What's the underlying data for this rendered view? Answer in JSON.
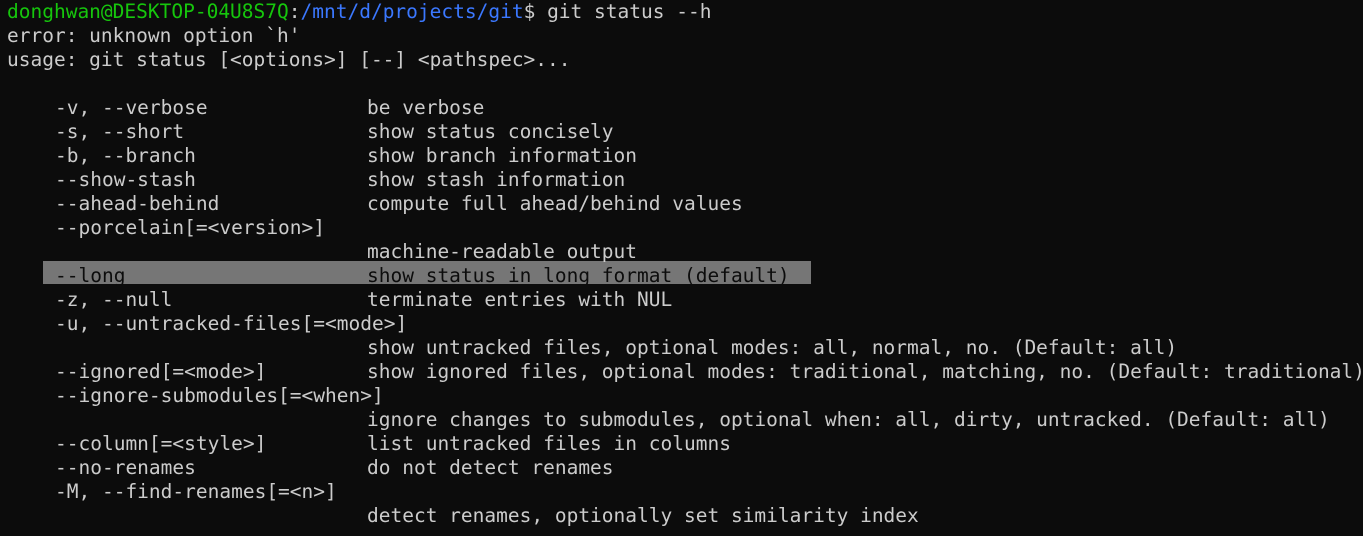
{
  "prompt": {
    "user_host": "donghwan@DESKTOP-04U8S7Q",
    "separator": ":",
    "cwd": "/mnt/d/projects/git",
    "symbol": "$",
    "command": " git status --h"
  },
  "error_line": "error: unknown option `h'",
  "usage_line": "usage: git status [<options>] [--] <pathspec>...",
  "options": [
    {
      "flag": "-v, --verbose",
      "desc": "be verbose"
    },
    {
      "flag": "-s, --short",
      "desc": "show status concisely"
    },
    {
      "flag": "-b, --branch",
      "desc": "show branch information"
    },
    {
      "flag": "--show-stash",
      "desc": "show stash information"
    },
    {
      "flag": "--ahead-behind",
      "desc": "compute full ahead/behind values"
    },
    {
      "flag": "--porcelain[=<version>]",
      "desc": ""
    },
    {
      "flag": "",
      "desc": "machine-readable output"
    },
    {
      "flag": "--long",
      "desc": "show status in long format (default)"
    },
    {
      "flag": "-z, --null",
      "desc": "terminate entries with NUL"
    },
    {
      "flag": "-u, --untracked-files[=<mode>]",
      "desc": ""
    },
    {
      "flag": "",
      "desc": "show untracked files, optional modes: all, normal, no. (Default: all)"
    },
    {
      "flag": "--ignored[=<mode>]",
      "desc": "show ignored files, optional modes: traditional, matching, no. (Default: traditional)"
    },
    {
      "flag": "--ignore-submodules[=<when>]",
      "desc": ""
    },
    {
      "flag": "",
      "desc": "ignore changes to submodules, optional when: all, dirty, untracked. (Default: all)"
    },
    {
      "flag": "--column[=<style>]",
      "desc": "list untracked files in columns"
    },
    {
      "flag": "--no-renames",
      "desc": "do not detect renames"
    },
    {
      "flag": "-M, --find-renames[=<n>]",
      "desc": ""
    },
    {
      "flag": "",
      "desc": "detect renames, optionally set similarity index"
    }
  ],
  "colors": {
    "background": "#0c0c0c",
    "foreground": "#cccccc",
    "user_host": "#16c60c",
    "path": "#3b78ff",
    "selection": "#767676"
  }
}
